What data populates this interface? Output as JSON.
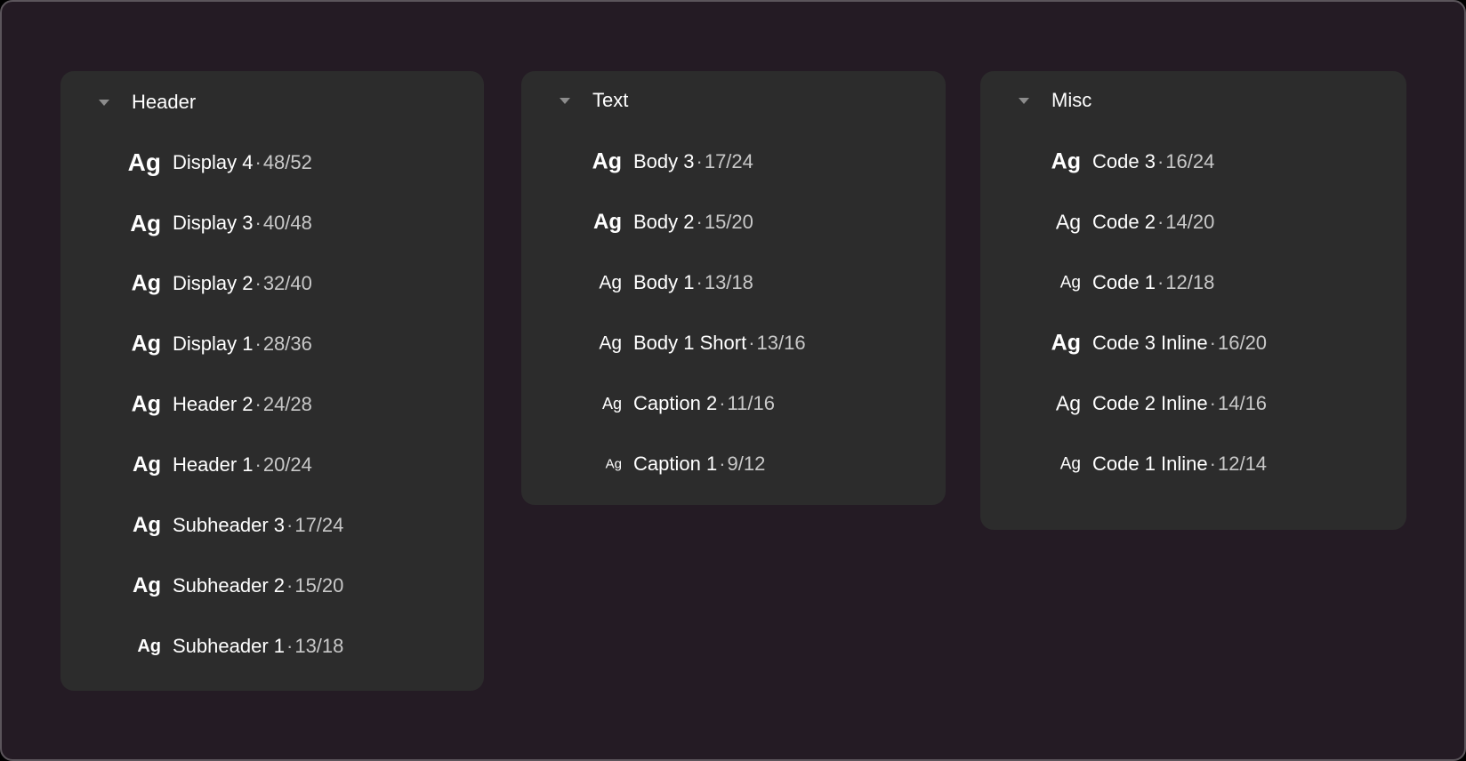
{
  "colors": {
    "background": "#241b24",
    "panel": "#2c2c2c",
    "text_primary": "#ffffff",
    "text_secondary": "#c9c9c9",
    "caret": "#8c8c8c"
  },
  "sample_glyph": "Ag",
  "separator": "·",
  "groups": [
    {
      "title": "Header",
      "icon": "caret-down-icon",
      "styles": [
        {
          "name": "Display 4",
          "metrics": "48/52"
        },
        {
          "name": "Display 3",
          "metrics": "40/48"
        },
        {
          "name": "Display 2",
          "metrics": "32/40"
        },
        {
          "name": "Display 1",
          "metrics": "28/36"
        },
        {
          "name": "Header 2",
          "metrics": "24/28"
        },
        {
          "name": "Header 1",
          "metrics": "20/24"
        },
        {
          "name": "Subheader 3",
          "metrics": "17/24"
        },
        {
          "name": "Subheader 2",
          "metrics": "15/20"
        },
        {
          "name": "Subheader 1",
          "metrics": "13/18"
        }
      ]
    },
    {
      "title": "Text",
      "icon": "caret-down-icon",
      "styles": [
        {
          "name": "Body 3",
          "metrics": "17/24"
        },
        {
          "name": "Body 2",
          "metrics": "15/20"
        },
        {
          "name": "Body 1",
          "metrics": "13/18"
        },
        {
          "name": "Body 1 Short",
          "metrics": "13/16"
        },
        {
          "name": "Caption 2",
          "metrics": "11/16"
        },
        {
          "name": "Caption 1",
          "metrics": "9/12"
        }
      ]
    },
    {
      "title": "Misc",
      "icon": "caret-down-icon",
      "styles": [
        {
          "name": "Code 3",
          "metrics": "16/24"
        },
        {
          "name": "Code 2",
          "metrics": "14/20"
        },
        {
          "name": "Code 1",
          "metrics": "12/18"
        },
        {
          "name": "Code 3 Inline",
          "metrics": "16/20"
        },
        {
          "name": "Code 2 Inline",
          "metrics": "14/16"
        },
        {
          "name": "Code 1 Inline",
          "metrics": "12/14"
        }
      ]
    }
  ]
}
